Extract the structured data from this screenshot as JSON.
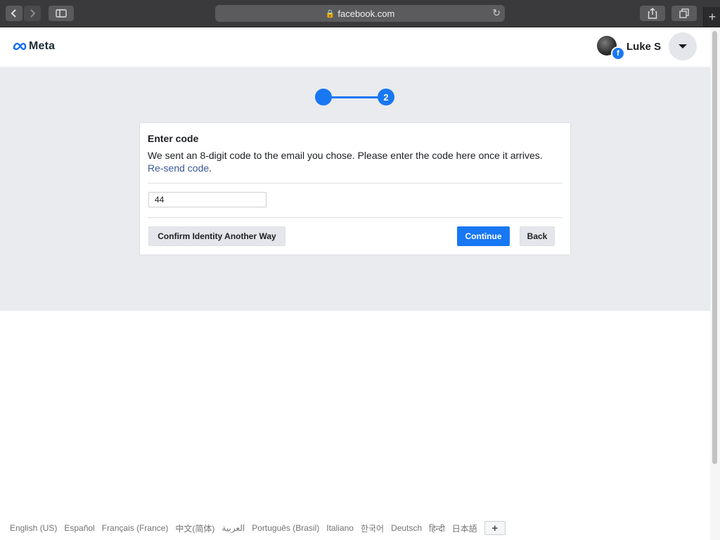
{
  "browser": {
    "url": "facebook.com",
    "back_icon": "chevron-left-icon",
    "forward_icon": "chevron-right-icon",
    "sidebar_icon": "sidebar-icon",
    "reload_icon": "reload-icon",
    "share_icon": "share-icon",
    "tabs_icon": "tabs-icon",
    "new_tab_icon": "plus-icon"
  },
  "header": {
    "brand": "Meta",
    "user_name": "Luke S"
  },
  "stepper": {
    "current_step": "2"
  },
  "card": {
    "title": "Enter code",
    "message": "We sent an 8-digit code to the email you chose. Please enter the code here once it arrives.",
    "resend_link": "Re-send code",
    "resend_suffix": ".",
    "code_value": "44",
    "alt_button": "Confirm Identity Another Way",
    "continue_button": "Continue",
    "back_button": "Back"
  },
  "footer": {
    "languages": [
      "English (US)",
      "Español",
      "Français (France)",
      "中文(简体)",
      "العربية",
      "Português (Brasil)",
      "Italiano",
      "한국어",
      "Deutsch",
      "हिन्दी",
      "日本語"
    ]
  },
  "colors": {
    "primary": "#1877f2",
    "link": "#385898",
    "page_grey": "#e9ebee"
  }
}
